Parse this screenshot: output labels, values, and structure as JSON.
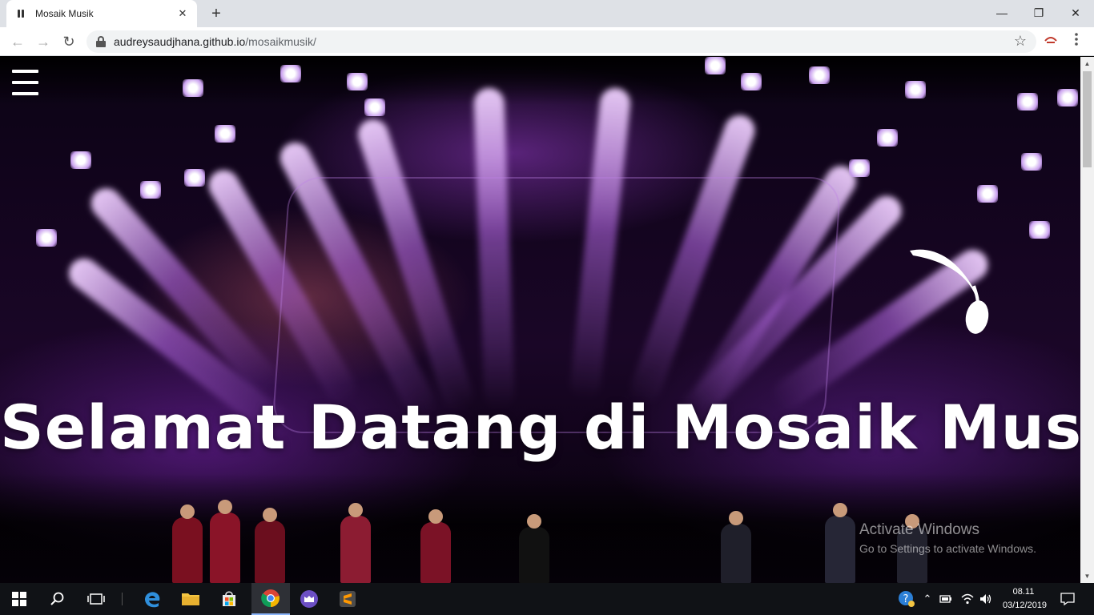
{
  "browser": {
    "tab_title": "Mosaik Musik",
    "tab_close": "✕",
    "new_tab": "+",
    "url_domain": "audreysaudjhana.github.io",
    "url_path": "/mosaikmusik/",
    "window_controls": {
      "minimize": "—",
      "maximize": "❐",
      "close": "✕"
    },
    "nav": {
      "back": "←",
      "forward": "→",
      "reload": "↻"
    },
    "star": "☆"
  },
  "page": {
    "hero_title": "Selamat Datang di Mosaik Musik"
  },
  "watermark": {
    "line1": "Activate Windows",
    "line2": "Go to Settings to activate Windows."
  },
  "taskbar": {
    "apps": [
      "start-icon",
      "search-icon",
      "task-view-icon",
      "edge-icon",
      "file-explorer-icon",
      "store-icon",
      "chrome-icon",
      "app-icon",
      "sublime-text-icon"
    ],
    "active_app": "chrome-icon",
    "clock_time": "08.11",
    "clock_date": "03/12/2019"
  },
  "colors": {
    "accent_purple": "#9b3fd6",
    "taskbar": "#101216",
    "tab_strip": "#dee1e6"
  }
}
